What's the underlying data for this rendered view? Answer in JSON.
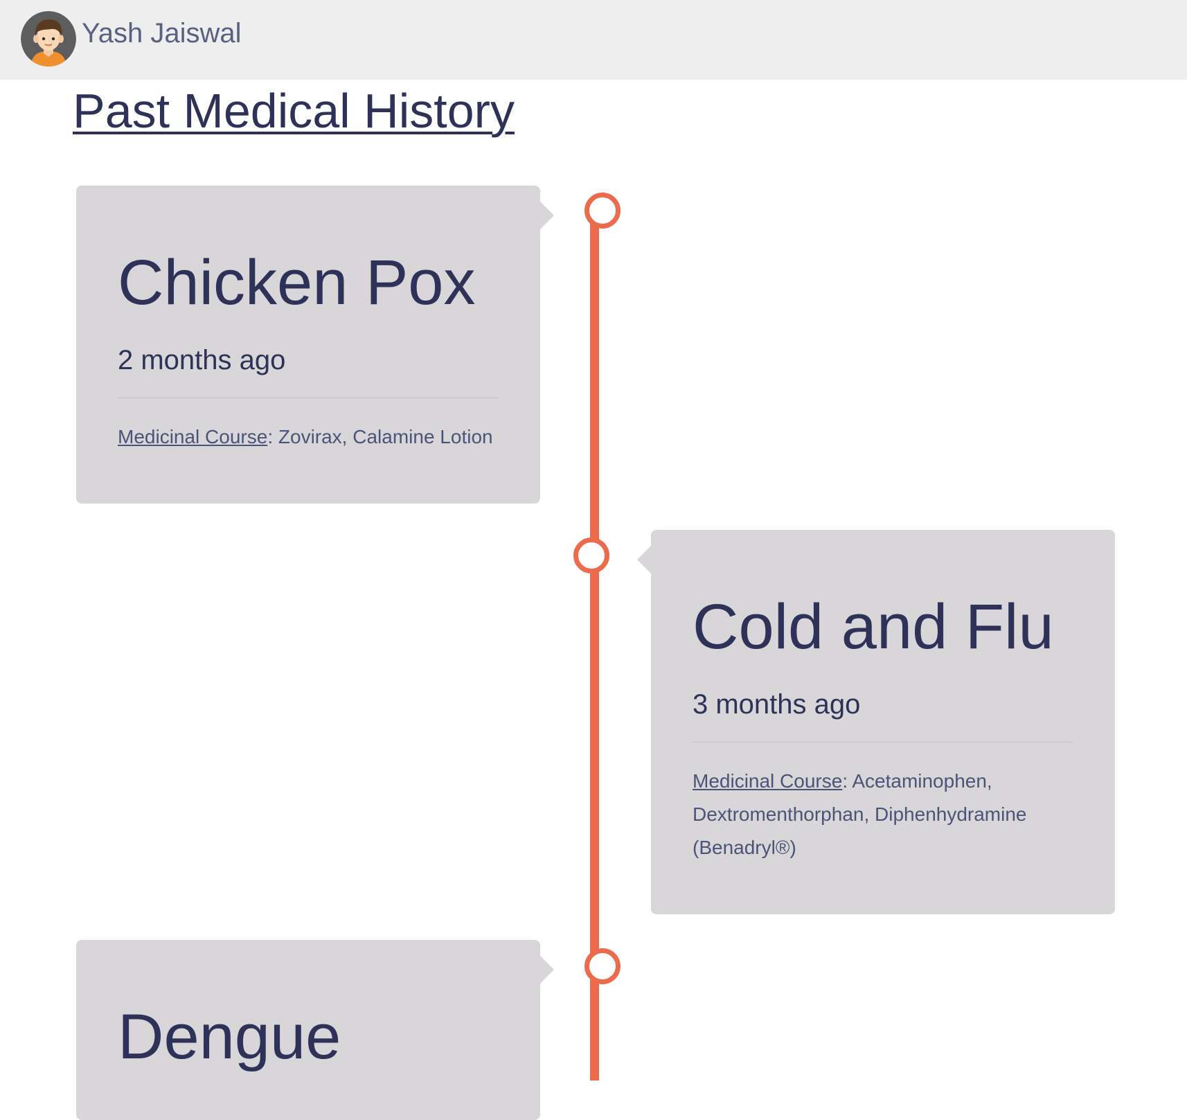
{
  "header": {
    "user_name": "Yash Jaiswal"
  },
  "page": {
    "title": "Past Medical History"
  },
  "colors": {
    "accent": "#ec6b4d",
    "card_bg": "#d8d6d8",
    "text": "#2e3158",
    "header_bg": "#eeeeee"
  },
  "history": [
    {
      "title": "Chicken Pox",
      "date": "2 months ago",
      "course_label": "Medicinal Course",
      "course_sep": ": ",
      "course_value": "Zovirax, Calamine Lotion"
    },
    {
      "title": "Cold and Flu",
      "date": "3 months ago",
      "course_label": "Medicinal Course",
      "course_sep": ": ",
      "course_value": "Acetaminophen, Dextromenthorphan, Diphenhydramine (Benadryl®)"
    },
    {
      "title": "Dengue"
    }
  ]
}
